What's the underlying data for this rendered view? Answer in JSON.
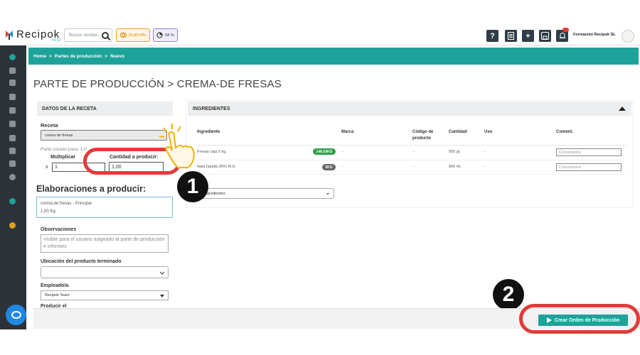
{
  "app": {
    "name": "Recipok",
    "version": "V4.19"
  },
  "header": {
    "search_placeholder": "Buscar recetas..",
    "cost_pill": "31,60 €/hr",
    "percent_pill": "58 %",
    "company": "Formación Recipok SL"
  },
  "breadcrumb": {
    "home": "Home",
    "sep": ">",
    "parent": "Partes de producción",
    "current": "Nuevo"
  },
  "page": {
    "title": "PARTE DE PRODUCCIÓN > CREMA-DE FRESAS"
  },
  "recipe_panel": {
    "heading": "DATOS DE LA RECETA",
    "receta_label": "Receta",
    "receta_value": "crema de fresas",
    "created_for": "Parte creado para: 1,0",
    "multiplicar_label": "Multiplicar",
    "x_label": "x",
    "multiplicar_value": "1",
    "cantidad_label": "Cantidad a producir:",
    "cantidad_value": "1,00",
    "elab_title": "Elaboraciones a producir:",
    "elab_line1": "crema-de fresas - Principal",
    "elab_line2": "1,00 Kg.",
    "obs_label": "Observaciones",
    "obs_placeholder": "Visible para el usuario asignado al parte de producción e informes",
    "ubic_label": "Ubicación del producto terminado",
    "emp_label": "Empleado/a",
    "emp_value": "Recipok Team",
    "producir_label": "Producir el"
  },
  "ingredients": {
    "heading": "INGREDIENTES",
    "columns": [
      "Ingrediente",
      "Marca",
      "Código de producto",
      "Cantidad",
      "Uso",
      "Coment."
    ],
    "rows": [
      {
        "name": "Fresas caja 5 kg.",
        "badge": "148,03KG",
        "badge_color": "#2e9d47",
        "marca": "-",
        "codigo": "-",
        "cantidad": "500 gr.",
        "uso": "-",
        "coment_placeholder": "Comentarios"
      },
      {
        "name": "Nata líquida 35% M.G",
        "badge": "0KG",
        "badge_color": "#666666",
        "marca": "-",
        "codigo": "-",
        "cantidad": "500 ml.",
        "uso": "-",
        "coment_placeholder": "Comentarios"
      }
    ],
    "filter_value": "ngredientes"
  },
  "steps": {
    "one": "1",
    "two": "2"
  },
  "footer": {
    "create_button": "Crear Orden de Producción"
  },
  "colors": {
    "teal": "#1ea39a",
    "sidebar": "#2c3338",
    "highlight": "#e23a3a"
  }
}
